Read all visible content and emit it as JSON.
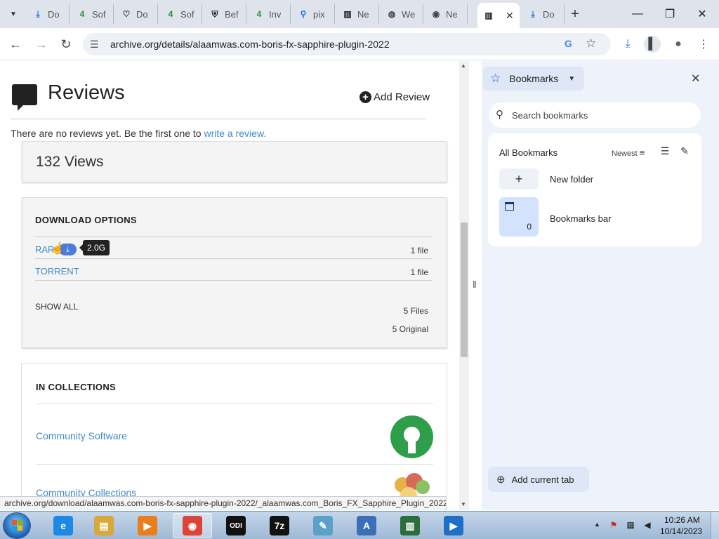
{
  "browser": {
    "tabs": [
      {
        "label": "Do",
        "icon": "download-icon",
        "color": "#1a73e8"
      },
      {
        "label": "Sof",
        "icon": "4shared-icon",
        "color": "#2a8a3a"
      },
      {
        "label": "Do",
        "icon": "heart-shield-icon",
        "color": "#222222"
      },
      {
        "label": "Sof",
        "icon": "4shared-icon",
        "color": "#2a8a3a"
      },
      {
        "label": "Bef",
        "icon": "shield-icon",
        "color": "#222222"
      },
      {
        "label": "Inv",
        "icon": "4shared-icon",
        "color": "#2a8a3a"
      },
      {
        "label": "pix",
        "icon": "search-icon",
        "color": "#1a73e8"
      },
      {
        "label": "Ne",
        "icon": "archive-icon",
        "color": "#222222"
      },
      {
        "label": "We",
        "icon": "globe-icon",
        "color": "#444444"
      },
      {
        "label": "Ne",
        "icon": "chrome-icon",
        "color": "#444444"
      },
      {
        "label": "",
        "icon": "archive-icon",
        "color": "#222222",
        "active": true
      },
      {
        "label": "Do",
        "icon": "download-icon",
        "color": "#1a73e8"
      }
    ],
    "new_tab": "+",
    "url": "archive.org/details/alaamwas.com-boris-fx-sapphire-plugin-2022"
  },
  "page": {
    "reviews_title": "Reviews",
    "add_review": "Add Review",
    "no_reviews_text": "There are no reviews yet. Be the first one to ",
    "write_review_link": "write a review.",
    "views": "132 Views",
    "download_options_title": "DOWNLOAD OPTIONS",
    "downloads": [
      {
        "label": "RAR",
        "count": "1 file"
      },
      {
        "label": "TORRENT",
        "count": "1 file"
      }
    ],
    "tooltip_size": "2.0G",
    "show_all": "SHOW ALL",
    "files_count": "5 Files",
    "original_count": "5 Original",
    "collections_title": "IN COLLECTIONS",
    "collections": [
      "Community Software",
      "Community Collections"
    ]
  },
  "status_bar": "archive.org/download/alaamwas.com-boris-fx-sapphire-plugin-2022/_alaamwas.com_Boris_FX_Sapphire_Plugin_2022...",
  "bookmarks_panel": {
    "title": "Bookmarks",
    "search_placeholder": "Search bookmarks",
    "all_bookmarks": "All Bookmarks",
    "sort": "Newest",
    "new_folder": "New folder",
    "bookmarks_bar": "Bookmarks bar",
    "bookmarks_bar_count": "0",
    "add_current_tab": "Add current tab"
  },
  "taskbar": {
    "time": "10:26 AM",
    "date": "10/14/2023",
    "apps": [
      {
        "name": "internet-explorer",
        "color": "#1e88e5",
        "glyph": "e"
      },
      {
        "name": "file-explorer",
        "color": "#d8a93a",
        "glyph": "▤"
      },
      {
        "name": "media-player",
        "color": "#e87f1c",
        "glyph": "▶"
      },
      {
        "name": "chrome",
        "color": "#db4437",
        "glyph": "◉",
        "active": true
      },
      {
        "name": "odi-app",
        "color": "#111111",
        "glyph": "ODI"
      },
      {
        "name": "7zip",
        "color": "#111111",
        "glyph": "7z"
      },
      {
        "name": "notepad-app",
        "color": "#5aa0c8",
        "glyph": "✎"
      },
      {
        "name": "document-app",
        "color": "#3d6fb6",
        "glyph": "A"
      },
      {
        "name": "terminal-app",
        "color": "#2a6e3a",
        "glyph": "▥"
      },
      {
        "name": "media-app",
        "color": "#1e6fc7",
        "glyph": "▶"
      }
    ]
  }
}
